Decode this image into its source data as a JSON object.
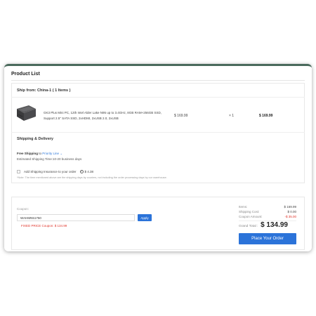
{
  "page": {
    "title": "Product List"
  },
  "shipment": {
    "ship_from": "Ship from: China-1 ( 1 Items )"
  },
  "product": {
    "name": "GK3 Plus Mini PC, 12th Intel Alder Lake N95 up to 3.4GHz, 8GB RAM+256GB SSD, Support 2.5\" SATA SSD, 2xHDMI, 2xUSB 2.0, 2xUSB",
    "unit_price": "$ 169.99",
    "quantity": "× 1",
    "total": "$ 169.99"
  },
  "shipping": {
    "title": "Shipping & Delivery",
    "free_label": "Free Shipping",
    "to_word": " to ",
    "method": "Priority Line",
    "estimate": "Estimated Shipping Time:10-20 business days",
    "insurance_label": "Add Shipping Insurance to your order",
    "insurance_price": "$ 4.38",
    "note": "*Note: The time mentioned above are the shipping days by couriers, not including the order processing days by our warehouse."
  },
  "coupon": {
    "label": "Coupon:",
    "value": "WAHMN51750",
    "apply_label": "Apply",
    "fixed_price_text": "FIXED PRICE Coupon: $ 134.99"
  },
  "summary": {
    "items_label": "Items:",
    "items_value": "$ 169.99",
    "shipping_label": "Shipping Cost:",
    "shipping_value": "$ 0.00",
    "coupon_label": "Coupon Amount:",
    "coupon_value": "-$ 35.00",
    "grand_total_label": "Grand Total :",
    "grand_total_value": "$ 134.99",
    "place_order_label": "Place Your Order"
  },
  "colors": {
    "accent": "#2b73d9",
    "discount": "#e0352b",
    "link": "#2f78d8"
  },
  "icons": {
    "product_image": "mini-pc-image",
    "method_dropdown": "chevron-down-icon",
    "insurance_info": "shield-icon"
  }
}
